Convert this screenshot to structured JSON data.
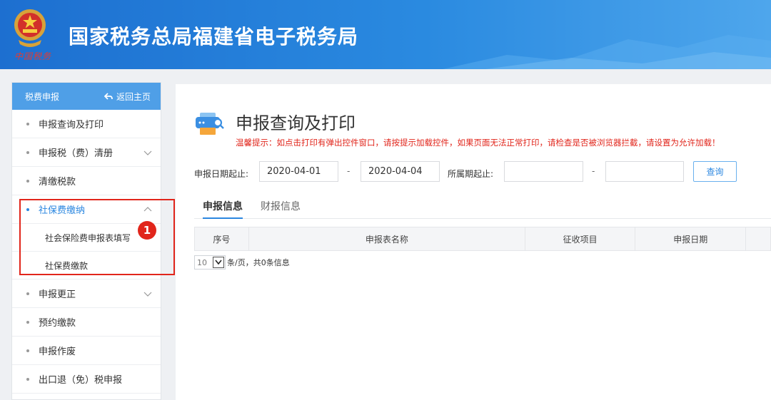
{
  "header": {
    "site_title": "国家税务总局福建省电子税务局",
    "emblem_caption": "中国税务",
    "brand_color": "#1d6fd0"
  },
  "sidebar": {
    "section_title": "税费申报",
    "back_label": "返回主页",
    "items": [
      {
        "label": "申报查询及打印"
      },
      {
        "label": "申报税（费）清册"
      },
      {
        "label": "清缴税款"
      },
      {
        "label": "社保费缴纳"
      },
      {
        "label": "申报更正"
      },
      {
        "label": "预约缴款"
      },
      {
        "label": "申报作废"
      },
      {
        "label": "出口退（免）税申报"
      }
    ],
    "sub_items": [
      {
        "label": "社会保险费申报表填写"
      },
      {
        "label": "社保费缴款"
      }
    ],
    "annotation_badge": "1"
  },
  "main": {
    "page_title": "申报查询及打印",
    "warning": "温馨提示：如点击打印有弹出控件窗口，请按提示加载控件，如果页面无法正常打印，请检查是否被浏览器拦截，请设置为允许加载！",
    "filters": {
      "date_label": "申报日期起止:",
      "date_from": "2020-04-01",
      "date_sep": "-",
      "date_to": "2020-04-04",
      "period_label": "所属期起止:",
      "period_from": "",
      "period_sep": "-",
      "period_to": "",
      "query_button": "查询"
    },
    "tabs": [
      {
        "label": "申报信息",
        "active": true
      },
      {
        "label": "财报信息",
        "active": false
      }
    ],
    "table": {
      "columns": [
        "序号",
        "申报表名称",
        "征收项目",
        "申报日期",
        ""
      ]
    },
    "pager": {
      "page_size": "10",
      "summary": "条/页，共0条信息"
    }
  }
}
